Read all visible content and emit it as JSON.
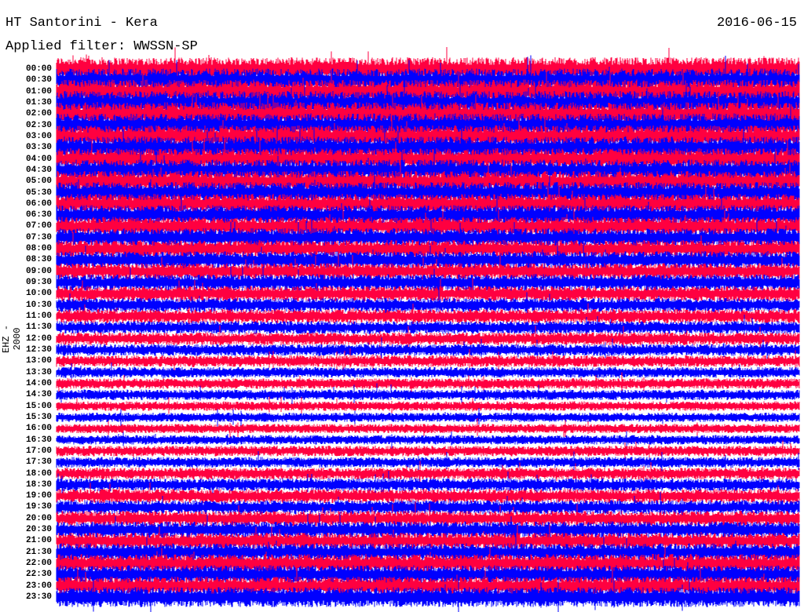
{
  "header": {
    "station": "HT Santorini - Kera",
    "date": "2016-06-15",
    "filter": "Applied filter: WWSSN-SP",
    "channel": "EHZ - 2000"
  },
  "colors": {
    "even_trace": "#FF0040",
    "odd_trace": "#0000FF"
  },
  "chart_data": {
    "type": "line",
    "title": "HT Santorini - Kera",
    "ylabel": "EHZ - 2000",
    "row_labels": [
      "00:00",
      "00:30",
      "01:00",
      "01:30",
      "02:00",
      "02:30",
      "03:00",
      "03:30",
      "04:00",
      "04:30",
      "05:00",
      "05:30",
      "06:00",
      "06:30",
      "07:00",
      "07:30",
      "08:00",
      "08:30",
      "09:00",
      "09:30",
      "10:00",
      "10:30",
      "11:00",
      "11:30",
      "12:00",
      "12:30",
      "13:00",
      "13:30",
      "14:00",
      "14:30",
      "15:00",
      "15:30",
      "16:00",
      "16:30",
      "17:00",
      "17:30",
      "18:00",
      "18:30",
      "19:00",
      "19:30",
      "20:00",
      "20:30",
      "21:00",
      "21:30",
      "22:00",
      "22:30",
      "23:00",
      "23:30"
    ],
    "relative_amplitude": [
      1.0,
      1.0,
      1.0,
      1.0,
      1.0,
      1.0,
      0.95,
      0.95,
      0.9,
      0.9,
      0.9,
      0.9,
      0.85,
      0.85,
      0.8,
      0.8,
      0.75,
      0.75,
      0.7,
      0.7,
      0.65,
      0.6,
      0.6,
      0.55,
      0.55,
      0.5,
      0.5,
      0.45,
      0.45,
      0.45,
      0.4,
      0.4,
      0.4,
      0.4,
      0.45,
      0.45,
      0.5,
      0.55,
      0.6,
      0.6,
      0.65,
      0.7,
      0.7,
      0.75,
      0.8,
      0.8,
      0.8,
      0.85
    ],
    "row_minutes": 30
  }
}
